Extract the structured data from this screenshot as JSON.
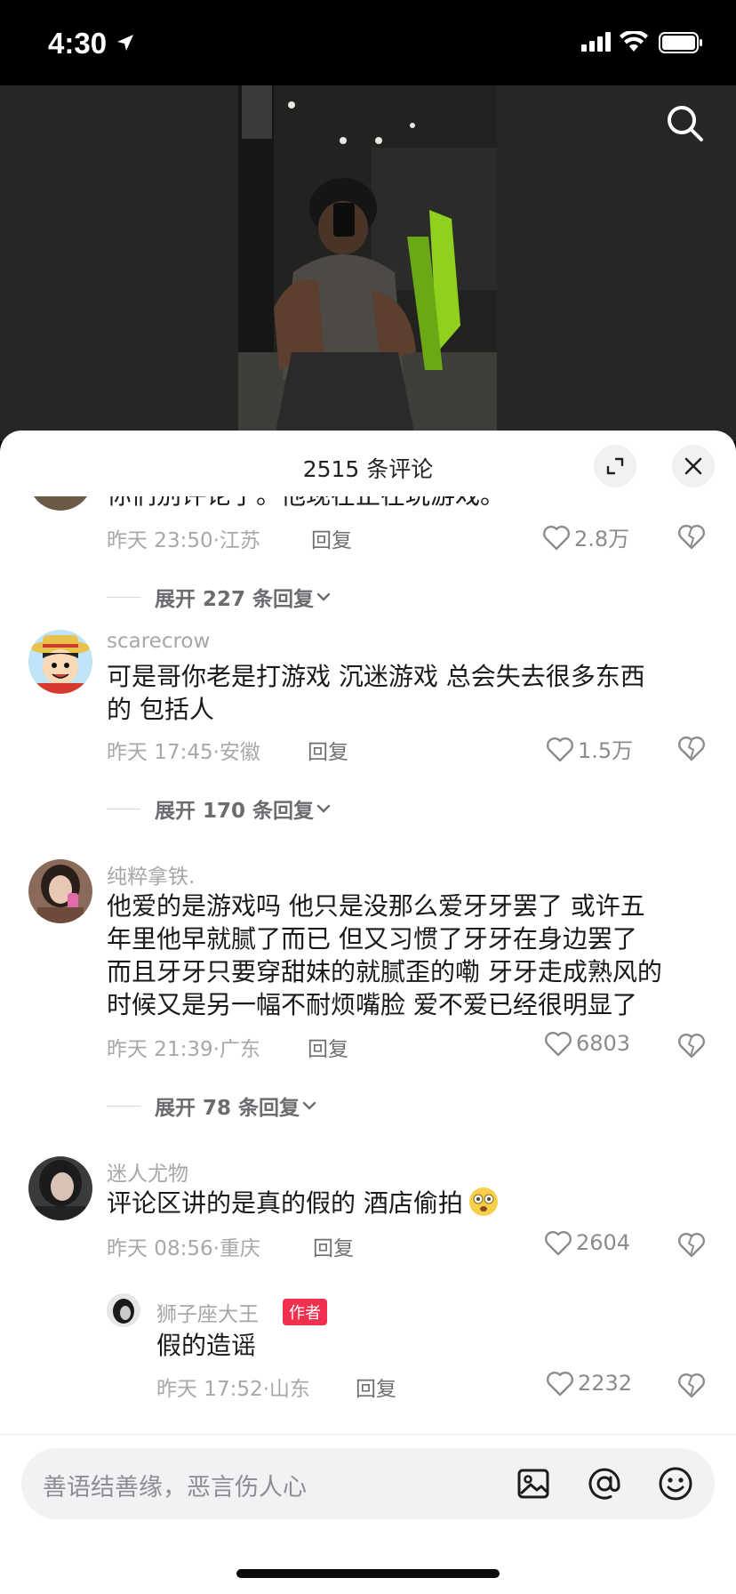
{
  "status_bar": {
    "time": "4:30"
  },
  "sheet": {
    "title": "2515 条评论"
  },
  "comments": [
    {
      "text_lines": [
        "你们别评论了。他现在正在玩游戏。"
      ],
      "time": "昨天 23:50",
      "location": "江苏",
      "reply_label": "回复",
      "likes": "2.8万",
      "expand_label": "展开 227 条回复"
    },
    {
      "user": "scarecrow",
      "text_lines": [
        "可是哥你老是打游戏  沉迷游戏 总会失去很多东西",
        "的  包括人"
      ],
      "time": "昨天 17:45",
      "location": "安徽",
      "reply_label": "回复",
      "likes": "1.5万",
      "expand_label": "展开 170 条回复"
    },
    {
      "user": "纯粹拿铁.",
      "text_lines": [
        "他爱的是游戏吗 他只是没那么爱牙牙罢了 或许五",
        "年里他早就腻了而已 但又习惯了牙牙在身边罢了",
        "而且牙牙只要穿甜妹的就腻歪的嘞 牙牙走成熟风的",
        "时候又是另一幅不耐烦嘴脸  爱不爱已经很明显了"
      ],
      "time": "昨天 21:39",
      "location": "广东",
      "reply_label": "回复",
      "likes": "6803",
      "expand_label": "展开 78 条回复"
    },
    {
      "user": "迷人尤物",
      "text_lines": [
        "评论区讲的是真的假的 酒店偷拍"
      ],
      "time": "昨天 08:56",
      "location": "重庆",
      "reply_label": "回复",
      "likes": "2604",
      "replies": [
        {
          "user": "狮子座大王",
          "badge": "作者",
          "text": "假的造谣",
          "time": "昨天 17:52",
          "location": "山东",
          "reply_label": "回复",
          "likes": "2232"
        }
      ]
    }
  ],
  "input": {
    "placeholder": "善语结善缘，恶言伤人心"
  },
  "icons": {
    "search": "search-icon",
    "expand": "expand-icon",
    "close": "close-icon",
    "like": "heart-icon",
    "dislike": "broken-heart-icon",
    "image": "image-icon",
    "mention": "at-icon",
    "emoji": "emoji-icon"
  },
  "colors": {
    "badge": "#f0304c",
    "sheet_bg": "#ffffff",
    "video_bg": "#262725"
  }
}
